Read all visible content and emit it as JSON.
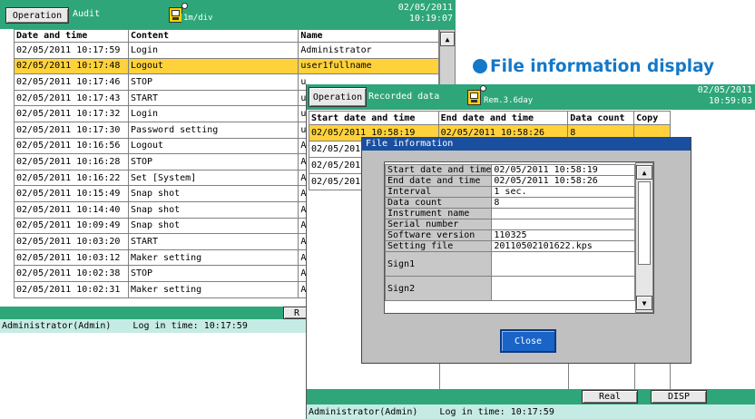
{
  "callout": {
    "text": "File information display"
  },
  "audit_screen": {
    "operation_label": "Operation",
    "mode_label": "Audit",
    "rate": "1m/div",
    "date": "02/05/2011",
    "time": "10:19:07",
    "columns": [
      "Date and time",
      "Content",
      "Name"
    ],
    "rows": [
      {
        "datetime": "02/05/2011 10:17:59",
        "content": "Login",
        "name": "Administrator"
      },
      {
        "datetime": "02/05/2011 10:17:48",
        "content": "Logout",
        "name": "user1fullname"
      },
      {
        "datetime": "02/05/2011 10:17:46",
        "content": "STOP",
        "name": "u"
      },
      {
        "datetime": "02/05/2011 10:17:43",
        "content": "START",
        "name": "u"
      },
      {
        "datetime": "02/05/2011 10:17:32",
        "content": "Login",
        "name": "u"
      },
      {
        "datetime": "02/05/2011 10:17:30",
        "content": "Password setting",
        "name": "u"
      },
      {
        "datetime": "02/05/2011 10:16:56",
        "content": "Logout",
        "name": "A"
      },
      {
        "datetime": "02/05/2011 10:16:28",
        "content": "STOP",
        "name": "A"
      },
      {
        "datetime": "02/05/2011 10:16:22",
        "content": "Set [System]",
        "name": "A"
      },
      {
        "datetime": "02/05/2011 10:15:49",
        "content": "Snap shot",
        "name": "A"
      },
      {
        "datetime": "02/05/2011 10:14:40",
        "content": "Snap shot",
        "name": "A"
      },
      {
        "datetime": "02/05/2011 10:09:49",
        "content": "Snap shot",
        "name": "A"
      },
      {
        "datetime": "02/05/2011 10:03:20",
        "content": "START",
        "name": "A"
      },
      {
        "datetime": "02/05/2011 10:03:12",
        "content": "Maker setting",
        "name": "A"
      },
      {
        "datetime": "02/05/2011 10:02:38",
        "content": "STOP",
        "name": "A"
      },
      {
        "datetime": "02/05/2011 10:02:31",
        "content": "Maker setting",
        "name": "A"
      }
    ],
    "softkey_partial": "R",
    "status_user": "Administrator(Admin)",
    "status_login": "Log in time: 10:17:59"
  },
  "recorded_screen": {
    "operation_label": "Operation",
    "mode_label": "Recorded data",
    "rate": "Rem.3.6day",
    "date": "02/05/2011",
    "time": "10:59:03",
    "columns": [
      "Start date and time",
      "End date and time",
      "Data count",
      "Copy"
    ],
    "rows": [
      {
        "start": "02/05/2011 10:58:19",
        "end": "02/05/2011 10:58:26",
        "count": "8",
        "copy": ""
      },
      {
        "start": "02/05/201",
        "end": "",
        "count": "",
        "copy": ""
      },
      {
        "start": "02/05/201",
        "end": "",
        "count": "",
        "copy": ""
      },
      {
        "start": "02/05/201",
        "end": "",
        "count": "",
        "copy": ""
      }
    ],
    "softkeys": [
      "Real",
      "DISP"
    ],
    "status_user": "Administrator(Admin)",
    "status_login": "Log in time: 10:17:59"
  },
  "file_info_dialog": {
    "title": "File information",
    "fields": [
      {
        "label": "Start date and time",
        "value": "02/05/2011 10:58:19"
      },
      {
        "label": "End date and time",
        "value": "02/05/2011 10:58:26"
      },
      {
        "label": "Interval",
        "value": "1 sec."
      },
      {
        "label": "Data count",
        "value": "8"
      },
      {
        "label": "Instrument name",
        "value": ""
      },
      {
        "label": "Serial number",
        "value": ""
      },
      {
        "label": "Software version",
        "value": "110325"
      },
      {
        "label": "Setting file",
        "value": "20110502101622.kps"
      },
      {
        "label": "Sign1",
        "value": ""
      },
      {
        "label": "Sign2",
        "value": ""
      }
    ],
    "close_label": "Close"
  },
  "colors": {
    "titlebar": "#2ea67a",
    "selection": "#ffd23c",
    "dialog_title": "#1a4fa0",
    "close_button": "#1a64c8",
    "callout": "#1478c8",
    "status": "#c5ece4"
  }
}
